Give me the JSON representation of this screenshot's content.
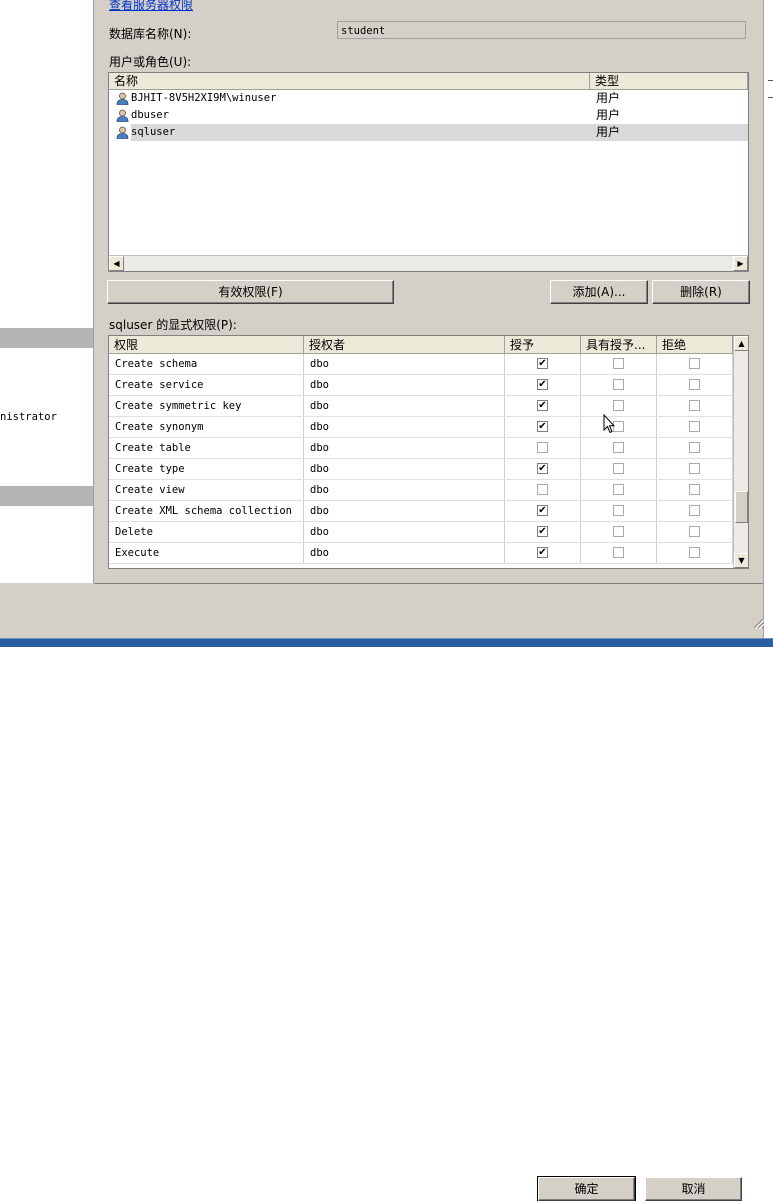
{
  "server_permissions_link": "查看服务器权限",
  "database": {
    "label": "数据库名称(N):",
    "value": "student"
  },
  "users": {
    "label": "用户或角色(U):",
    "columns": {
      "name": "名称",
      "type": "类型"
    },
    "rows": [
      {
        "name": "BJHIT-8V5H2XI9M\\winuser",
        "type": "用户",
        "selected": false
      },
      {
        "name": "dbuser",
        "type": "用户",
        "selected": false
      },
      {
        "name": "sqluser",
        "type": "用户",
        "selected": true
      }
    ]
  },
  "buttons": {
    "effective": "有效权限(F)",
    "add": "添加(A)...",
    "remove": "删除(R)",
    "ok": "确定",
    "cancel": "取消"
  },
  "permissions": {
    "label": "sqluser 的显式权限(P):",
    "columns": {
      "permission": "权限",
      "grantor": "授权者",
      "grant": "授予",
      "with_grant": "具有授予...",
      "deny": "拒绝"
    },
    "rows": [
      {
        "permission": "Create schema",
        "grantor": "dbo",
        "grant": true,
        "with_grant": false,
        "deny": false
      },
      {
        "permission": "Create service",
        "grantor": "dbo",
        "grant": true,
        "with_grant": false,
        "deny": false
      },
      {
        "permission": "Create symmetric key",
        "grantor": "dbo",
        "grant": true,
        "with_grant": false,
        "deny": false
      },
      {
        "permission": "Create synonym",
        "grantor": "dbo",
        "grant": true,
        "with_grant": false,
        "deny": false
      },
      {
        "permission": "Create table",
        "grantor": "dbo",
        "grant": false,
        "with_grant": false,
        "deny": false
      },
      {
        "permission": "Create type",
        "grantor": "dbo",
        "grant": true,
        "with_grant": false,
        "deny": false
      },
      {
        "permission": "Create view",
        "grantor": "dbo",
        "grant": false,
        "with_grant": false,
        "deny": false
      },
      {
        "permission": "Create XML schema collection",
        "grantor": "dbo",
        "grant": true,
        "with_grant": false,
        "deny": false
      },
      {
        "permission": "Delete",
        "grantor": "dbo",
        "grant": true,
        "with_grant": false,
        "deny": false
      },
      {
        "permission": "Execute",
        "grantor": "dbo",
        "grant": true,
        "with_grant": false,
        "deny": false
      }
    ]
  },
  "left_pane_text": "nistrator"
}
